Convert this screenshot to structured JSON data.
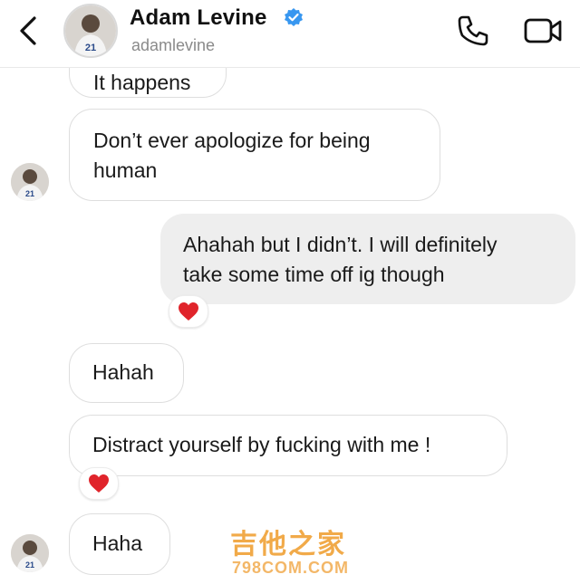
{
  "header": {
    "name": "Adam Levine",
    "handle": "adamlevine",
    "jersey_number": "21"
  },
  "messages": [
    {
      "from": "them",
      "text": "It happens",
      "partial": true
    },
    {
      "from": "them",
      "lines": [
        "Don’t ever apologize for being",
        "human"
      ]
    },
    {
      "from": "me",
      "lines": [
        "Ahahah but I didn’t. I will definitely",
        "take some time off ig though"
      ],
      "reaction": "heart"
    },
    {
      "from": "them",
      "text": "Hahah"
    },
    {
      "from": "them",
      "text": "Distract yourself by fucking with me !",
      "reaction": "heart"
    },
    {
      "from": "them",
      "text": "Haha"
    }
  ],
  "watermark": {
    "line1": "吉他之家",
    "line2": "798COM.COM"
  },
  "colors": {
    "verified": "#3897f0",
    "heart": "#e0242b",
    "outgoing_bubble": "#eeeeee",
    "watermark": "#f0a33a"
  }
}
